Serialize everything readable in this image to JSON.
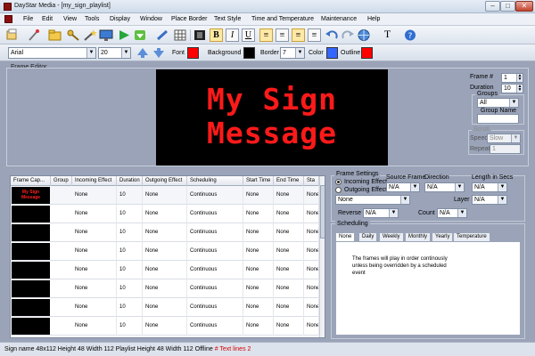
{
  "window": {
    "title": "DayStar Media - [my_sign_playlist]",
    "accent": "#8a1010"
  },
  "menu": [
    "File",
    "Edit",
    "View",
    "Tools",
    "Display",
    "Window",
    "Place Border",
    "Text Style",
    "Time and Temperature",
    "Maintenance",
    "Help"
  ],
  "toolbar": {
    "bold": "B",
    "italic": "I",
    "underline": "U",
    "text_tool": "T"
  },
  "format_bar": {
    "font_name": "Arial",
    "font_size": "20",
    "font_label": "Font",
    "font_color": "#ff0000",
    "background_label": "Background",
    "background_color": "#000000",
    "border_label": "Border",
    "border_value": "7",
    "color_label": "Color",
    "color_value": "#3366ff",
    "outline_label": "Outline",
    "outline_color": "#ff0000"
  },
  "frame_editor": {
    "title": "Frame Editor",
    "sign_lines": [
      "My Sign",
      "Message"
    ],
    "sign_color": "#ff1a1a",
    "frame_num_label": "Frame #",
    "frame_num": "1",
    "duration_label": "Duration",
    "duration": "10",
    "groups_label": "Groups",
    "groups_value": "All",
    "group_name_label": "Group Name",
    "scroll_label": "Scroll",
    "speed_label": "Speed",
    "speed_value": "Slow",
    "repeat_label": "Repeat",
    "repeat_value": "1"
  },
  "grid": {
    "columns": [
      "Frame Cap...",
      "Group",
      "Incoming Effect",
      "Duration",
      "Outgoing Effect",
      "Scheduling",
      "Start Time",
      "End Time",
      "Sta"
    ],
    "thumb_text": [
      "My Sign",
      "Message"
    ],
    "rows": [
      [
        "None",
        "10",
        "None",
        "Continuous",
        "None",
        "None",
        "None"
      ],
      [
        "None",
        "10",
        "None",
        "Continuous",
        "None",
        "None",
        "None"
      ],
      [
        "None",
        "10",
        "None",
        "Continuous",
        "None",
        "None",
        "None"
      ],
      [
        "None",
        "10",
        "None",
        "Continuous",
        "None",
        "None",
        "None"
      ],
      [
        "None",
        "10",
        "None",
        "Continuous",
        "None",
        "None",
        "None"
      ],
      [
        "None",
        "10",
        "None",
        "Continuous",
        "None",
        "None",
        "None"
      ],
      [
        "None",
        "10",
        "None",
        "Continuous",
        "None",
        "None",
        "None"
      ],
      [
        "None",
        "10",
        "None",
        "Continuous",
        "None",
        "None",
        "None"
      ]
    ]
  },
  "frame_settings": {
    "title": "Frame Settings",
    "incoming_label": "Incoming Effect",
    "outgoing_label": "Outgoing Effect",
    "effect_value": "None",
    "source_frame_label": "Source Frame",
    "source_frame_value": "N/A",
    "direction_label": "Direction",
    "direction_value": "N/A",
    "length_label": "Length in Secs",
    "length_value": "N/A",
    "layer_label": "Layer",
    "layer_value": "N/A",
    "reverse_label": "Reverse",
    "reverse_value": "N/A",
    "count_label": "Count",
    "count_value": "N/A"
  },
  "scheduling": {
    "title": "Scheduling",
    "tabs": [
      "None",
      "Daily",
      "Weekly",
      "Monthly",
      "Yearly",
      "Temperature"
    ],
    "message": "The frames will play in order continously unless being overridden by a scheduled event"
  },
  "status": {
    "text": "Sign name 48x112 Height 48 Width 112   Playlist Height 48 Width 112 Offline",
    "warning": "# Text lines 2"
  }
}
